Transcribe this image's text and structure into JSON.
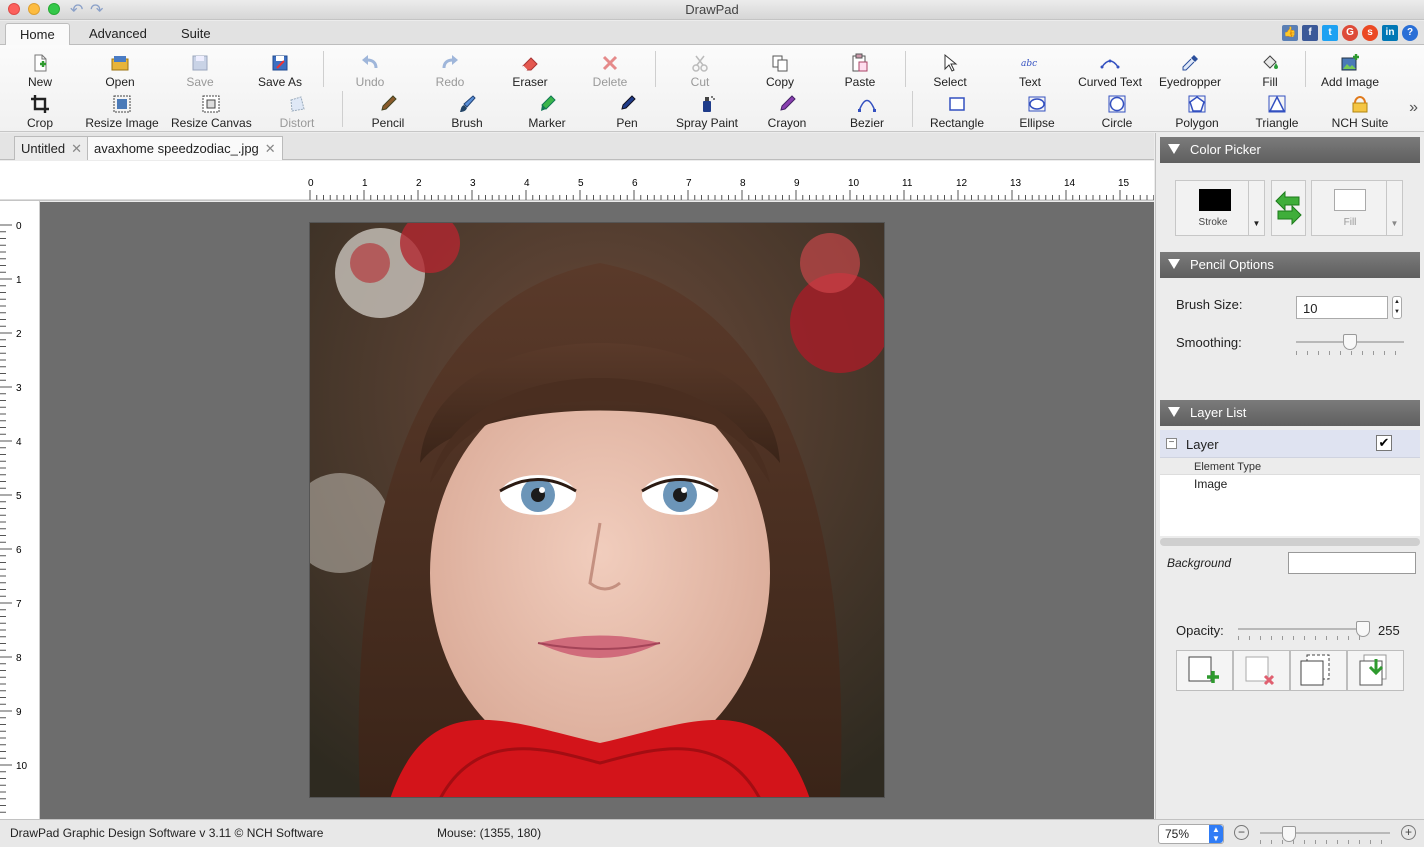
{
  "window": {
    "title": "DrawPad"
  },
  "ribbon_tabs": [
    {
      "label": "Home",
      "active": true
    },
    {
      "label": "Advanced",
      "active": false
    },
    {
      "label": "Suite",
      "active": false
    }
  ],
  "social_icons": [
    "thumbs-up-icon",
    "facebook-icon",
    "twitter-icon",
    "google-plus-icon",
    "stumbleupon-icon",
    "linkedin-icon",
    "help-icon"
  ],
  "toolbar": {
    "row1": [
      {
        "label": "New",
        "icon": "new-document-icon",
        "enabled": true
      },
      {
        "label": "Open",
        "icon": "open-folder-icon",
        "enabled": true
      },
      {
        "label": "Save",
        "icon": "save-icon",
        "enabled": false
      },
      {
        "label": "Save As",
        "icon": "save-as-icon",
        "enabled": true
      },
      {
        "label": "Undo",
        "icon": "undo-icon",
        "enabled": false
      },
      {
        "label": "Redo",
        "icon": "redo-icon",
        "enabled": false
      },
      {
        "label": "Eraser",
        "icon": "eraser-icon",
        "enabled": true
      },
      {
        "label": "Delete",
        "icon": "delete-icon",
        "enabled": false
      },
      {
        "label": "Cut",
        "icon": "scissors-icon",
        "enabled": false
      },
      {
        "label": "Copy",
        "icon": "copy-icon",
        "enabled": true
      },
      {
        "label": "Paste",
        "icon": "paste-icon",
        "enabled": true
      },
      {
        "label": "Select",
        "icon": "select-cursor-icon",
        "enabled": true
      },
      {
        "label": "Text",
        "icon": "text-icon",
        "enabled": true
      },
      {
        "label": "Curved Text",
        "icon": "curved-text-icon",
        "enabled": true
      },
      {
        "label": "Eyedropper",
        "icon": "eyedropper-icon",
        "enabled": true
      },
      {
        "label": "Fill",
        "icon": "paint-bucket-icon",
        "enabled": true
      },
      {
        "label": "Add Image",
        "icon": "add-image-icon",
        "enabled": true
      }
    ],
    "row2": [
      {
        "label": "Crop",
        "icon": "crop-icon",
        "enabled": true
      },
      {
        "label": "Resize Image",
        "icon": "resize-image-icon",
        "enabled": true
      },
      {
        "label": "Resize Canvas",
        "icon": "resize-canvas-icon",
        "enabled": true
      },
      {
        "label": "Distort",
        "icon": "distort-icon",
        "enabled": false
      },
      {
        "label": "Pencil",
        "icon": "pencil-icon",
        "enabled": true
      },
      {
        "label": "Brush",
        "icon": "brush-icon",
        "enabled": true
      },
      {
        "label": "Marker",
        "icon": "marker-icon",
        "enabled": true
      },
      {
        "label": "Pen",
        "icon": "pen-icon",
        "enabled": true
      },
      {
        "label": "Spray Paint",
        "icon": "spray-paint-icon",
        "enabled": true
      },
      {
        "label": "Crayon",
        "icon": "crayon-icon",
        "enabled": true
      },
      {
        "label": "Bezier",
        "icon": "bezier-icon",
        "enabled": true
      },
      {
        "label": "Rectangle",
        "icon": "rectangle-icon",
        "enabled": true
      },
      {
        "label": "Ellipse",
        "icon": "ellipse-icon",
        "enabled": true
      },
      {
        "label": "Circle",
        "icon": "circle-icon",
        "enabled": true
      },
      {
        "label": "Polygon",
        "icon": "polygon-icon",
        "enabled": true
      },
      {
        "label": "Triangle",
        "icon": "triangle-icon",
        "enabled": true
      },
      {
        "label": "NCH Suite",
        "icon": "nch-suite-icon",
        "enabled": true
      }
    ]
  },
  "documents": [
    {
      "label": "Untitled",
      "active": false
    },
    {
      "label": "avaxhome speedzodiac_.jpg",
      "active": true
    }
  ],
  "rulers": {
    "horizontal": [
      "0",
      "1",
      "2",
      "3",
      "4",
      "5",
      "6",
      "7",
      "8",
      "9",
      "10",
      "11",
      "12",
      "13",
      "14",
      "15"
    ],
    "vertical": [
      "0",
      "1",
      "2",
      "3",
      "4",
      "5",
      "6",
      "7",
      "8",
      "9",
      "10"
    ]
  },
  "panel": {
    "color_picker": {
      "title": "Color Picker",
      "stroke_label": "Stroke",
      "fill_label": "Fill",
      "stroke_color": "#000000",
      "fill_color": "#ffffff"
    },
    "pencil_options": {
      "title": "Pencil Options",
      "brush_size_label": "Brush Size:",
      "brush_size": "10",
      "smoothing_label": "Smoothing:",
      "smoothing_level": 0.5
    },
    "layer_list": {
      "title": "Layer List",
      "layer_name": "Layer",
      "layer_visible": true,
      "element_type_header": "Element Type",
      "element_type": "Image",
      "background_label": "Background",
      "opacity_label": "Opacity:",
      "opacity_value": "255",
      "opacity_level": 1.0
    }
  },
  "status": {
    "app_info": "DrawPad Graphic Design Software v 3.11 © NCH Software",
    "mouse": "Mouse: (1355, 180)",
    "zoom": "75%"
  }
}
